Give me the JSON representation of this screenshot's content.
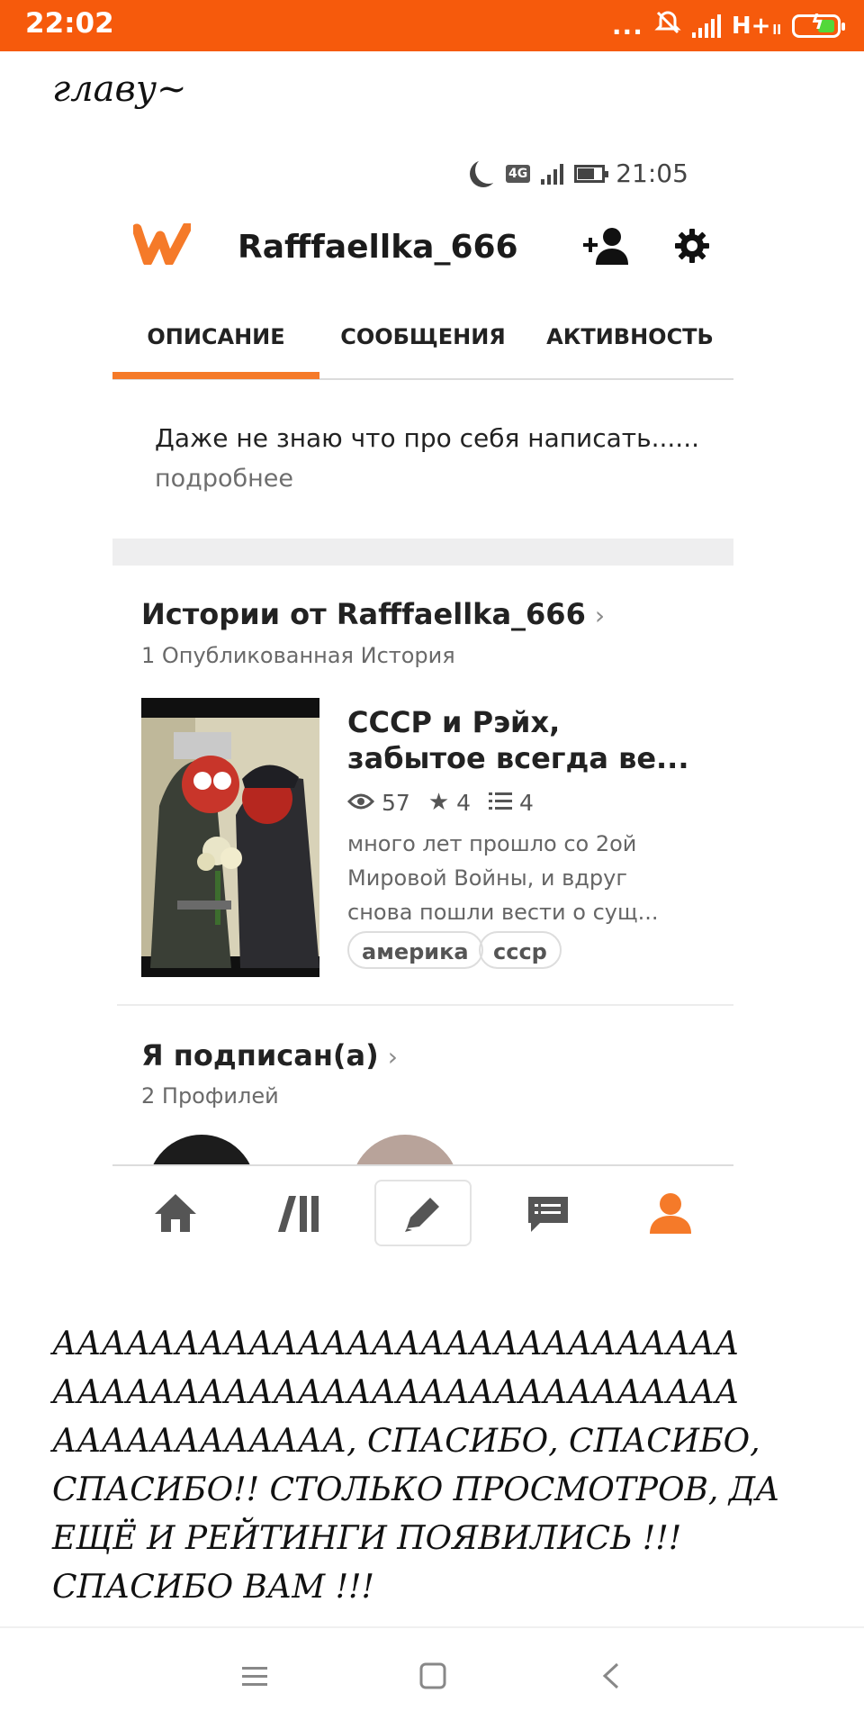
{
  "status_bar": {
    "time": "22:02",
    "dots": "...",
    "network": "H+",
    "network_sub": "ll"
  },
  "text_top": "главу~",
  "inner_status": {
    "network": "4G",
    "time": "21:05"
  },
  "profile": {
    "username": "Rafffaellka_666",
    "tabs": [
      "ОПИСАНИЕ",
      "СООБЩЕНИЯ",
      "АКТИВНОСТЬ"
    ],
    "active_tab": "ОПИСАНИЕ",
    "description": "Даже не знаю что про себя написать......",
    "more_label": "подробнее"
  },
  "stories": {
    "title": "Истории от Rafffaellka_666",
    "count_label": "1 Опубликованная История",
    "items": [
      {
        "title_line1": "СССР и Рэйх,",
        "title_line2": "забытое всегда ве...",
        "views": "57",
        "votes": "4",
        "parts": "4",
        "desc_line1": "много лет прошло со 2ой",
        "desc_line2": "Мировой Войны, и вдруг",
        "desc_line3": "снова пошли вести о сущ...",
        "tags": [
          "америка",
          "ссср"
        ]
      }
    ]
  },
  "following": {
    "title": "Я подписан(а)",
    "count_label": "2 Профилей"
  },
  "bottom_tabs": [
    "home-icon",
    "library-icon",
    "write-icon",
    "messages-icon",
    "profile-icon"
  ],
  "text_bottom": {
    "line1": "АААААААААААААААААААААААААААА",
    "line2": "АААААААААААААААААААААААААААА",
    "line3": "АААААААААААА, СПАСИБО, СПАСИБО,",
    "line4": "СПАСИБО!! СТОЛЬКО ПРОСМОТРОВ, ДА",
    "line5": "ЕЩЁ И РЕЙТИНГИ ПОЯВИЛИСЬ !!!",
    "line6": "СПАСИБО ВАМ !!!"
  },
  "colors": {
    "status_bar": "#f65a0c",
    "accent": "#f57a29",
    "battery_fill": "#53d83a"
  }
}
